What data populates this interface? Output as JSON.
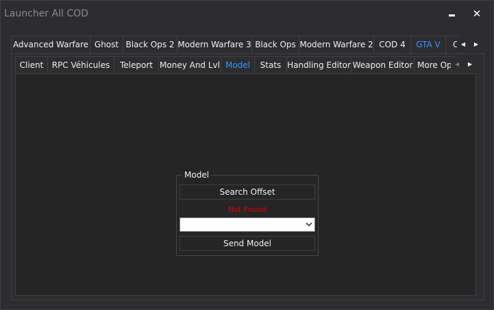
{
  "window": {
    "title": "Launcher All COD"
  },
  "top_tabs": [
    {
      "label": "Advanced Warfare"
    },
    {
      "label": "Ghost"
    },
    {
      "label": "Black Ops 2"
    },
    {
      "label": "Modern Warfare 3"
    },
    {
      "label": "Black Ops"
    },
    {
      "label": "Modern Warfare 2"
    },
    {
      "label": "COD 4"
    },
    {
      "label": "GTA V",
      "active": true
    },
    {
      "label": "C"
    }
  ],
  "sub_tabs": [
    {
      "label": "Client"
    },
    {
      "label": "RPC Véhicules"
    },
    {
      "label": "Teleport"
    },
    {
      "label": "Money And Lvl"
    },
    {
      "label": "Model",
      "active": true
    },
    {
      "label": "Stats"
    },
    {
      "label": "Handling Editor"
    },
    {
      "label": "Weapon Editor"
    },
    {
      "label": "More Opti"
    }
  ],
  "model_group": {
    "legend": "Model",
    "search_button": "Search Offset",
    "status": "Not Found",
    "combo_value": "",
    "send_button": "Send Model"
  },
  "colors": {
    "active_tab": "#3399ff",
    "status_error": "#e00000",
    "background": "#2d2d30"
  }
}
